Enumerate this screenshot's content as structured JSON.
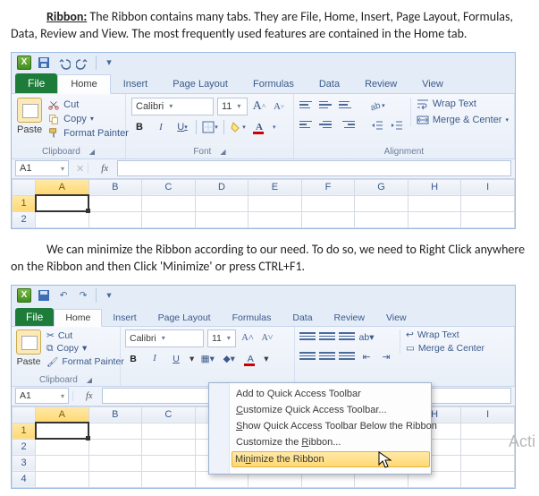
{
  "doc": {
    "p1_label": "Ribbon:",
    "p1_text": " The Ribbon contains many tabs. They are File, Home, Insert, Page Layout, Formulas, Data, Review and View. The most frequently used features are contained in the Home tab.",
    "p2_text": "We can minimize the Ribbon according to our need. To do so, we need to Right Click anywhere on the Ribbon and then Click 'Minimize' or press CTRL+F1.",
    "watermark": "Acti"
  },
  "qat": {
    "xicon": "X"
  },
  "tabs": {
    "file": "File",
    "home": "Home",
    "insert": "Insert",
    "pagelayout": "Page Layout",
    "formulas": "Formulas",
    "data": "Data",
    "review": "Review",
    "view": "View"
  },
  "clipboard": {
    "paste": "Paste",
    "cut": "Cut",
    "copy": "Copy",
    "format_painter": "Format Painter",
    "group": "Clipboard"
  },
  "font": {
    "name": "Calibri",
    "size": "11",
    "grow": "A",
    "shrink": "A",
    "b": "B",
    "i": "I",
    "u": "U",
    "fill_letter": "",
    "text_letter": "A",
    "group": "Font"
  },
  "alignment": {
    "wrap": "Wrap Text",
    "merge": "Merge & Center",
    "group": "Alignment"
  },
  "namebox": {
    "ref": "A1",
    "fx": "fx"
  },
  "cols": {
    "A": "A",
    "B": "B",
    "C": "C",
    "D": "D",
    "E": "E",
    "F": "F",
    "G": "G",
    "H": "H",
    "I": "I"
  },
  "rows": {
    "r1": "1",
    "r2": "2",
    "r3": "3",
    "r4": "4"
  },
  "ctx": {
    "i1": "Add to Quick Access Toolbar",
    "i2_pre": "",
    "i2": "Customize Quick Access Toolbar...",
    "i3_pre": "",
    "i3": "Show Quick Access Toolbar Below the Ribbon",
    "i4": "Customize the Ribbon...",
    "i5": "Minimize the Ribbon"
  }
}
